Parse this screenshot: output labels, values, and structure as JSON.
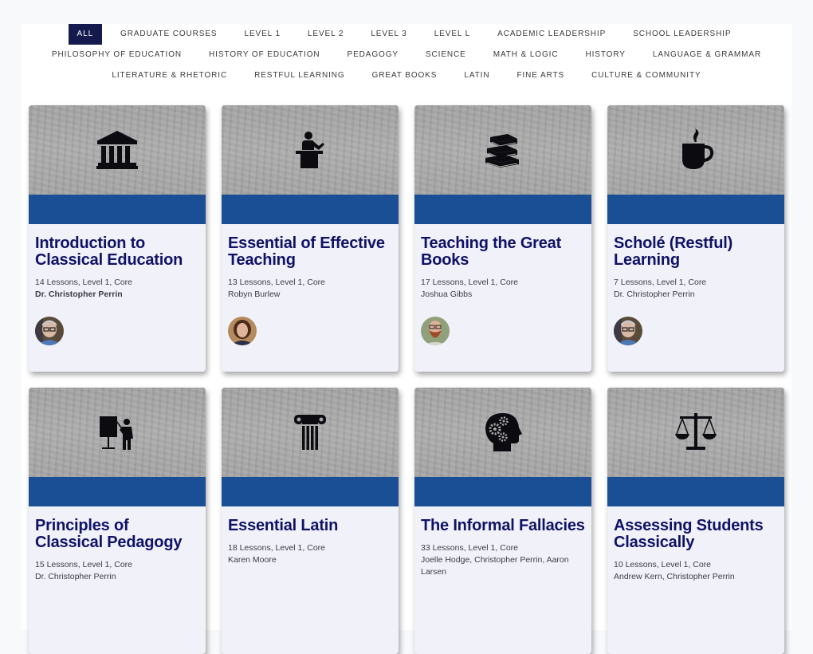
{
  "filters": {
    "rows": [
      [
        {
          "label": "All",
          "active": true
        },
        {
          "label": "Graduate Courses"
        },
        {
          "label": "Level 1"
        },
        {
          "label": "Level 2"
        },
        {
          "label": "Level 3"
        },
        {
          "label": "Level L"
        },
        {
          "label": "Academic Leadership"
        },
        {
          "label": "School Leadership"
        }
      ],
      [
        {
          "label": "Philosophy of Education"
        },
        {
          "label": "History of Education"
        },
        {
          "label": "Pedagogy"
        },
        {
          "label": "Science"
        },
        {
          "label": "Math & Logic"
        },
        {
          "label": "History"
        },
        {
          "label": "Language & Grammar"
        }
      ],
      [
        {
          "label": "Literature & Rhetoric"
        },
        {
          "label": "Restful Learning"
        },
        {
          "label": "Great Books"
        },
        {
          "label": "Latin"
        },
        {
          "label": "Fine Arts"
        },
        {
          "label": "Culture & Community"
        }
      ]
    ]
  },
  "colors": {
    "active_filter_bg": "#141a4e",
    "card_band": "#1a4f96",
    "title": "#101266",
    "card_bg": "#f0f1f9"
  },
  "courses": [
    {
      "title": "Introduction to Classical Education",
      "meta": "14 Lessons, Level 1, Core",
      "author": "Dr. Christopher Perrin",
      "author_bold": true,
      "icon": "institution-icon",
      "avatar": "avatar-christopher-perrin"
    },
    {
      "title": "Essential of Effective Teaching",
      "meta": "13 Lessons, Level 1, Core",
      "author": "Robyn Burlew",
      "icon": "teacher-podium-icon",
      "avatar": "avatar-robyn-burlew"
    },
    {
      "title": "Teaching the Great Books",
      "meta": "17 Lessons, Level 1, Core",
      "author": "Joshua Gibbs",
      "icon": "books-stack-icon",
      "avatar": "avatar-joshua-gibbs"
    },
    {
      "title": "Scholé (Restful) Learning",
      "meta": "7 Lessons, Level 1, Core",
      "author": "Dr. Christopher Perrin",
      "icon": "coffee-cup-icon",
      "avatar": "avatar-christopher-perrin"
    },
    {
      "title": "Principles of Classical Pedagogy",
      "meta": "15 Lessons, Level 1, Core",
      "author": "Dr. Christopher Perrin",
      "icon": "teacher-board-icon"
    },
    {
      "title": "Essential Latin",
      "meta": "18 Lessons, Level 1, Core",
      "author": "Karen Moore",
      "icon": "ionic-column-icon"
    },
    {
      "title": "The Informal Fallacies",
      "meta": "33 Lessons, Level 1, Core",
      "author": "Joelle Hodge, Christopher Perrin, Aaron Larsen",
      "icon": "head-gears-icon"
    },
    {
      "title": "Assessing Students Classically",
      "meta": "10 Lessons, Level 1, Core",
      "author": "Andrew Kern, Christopher Perrin",
      "icon": "scales-icon"
    }
  ]
}
